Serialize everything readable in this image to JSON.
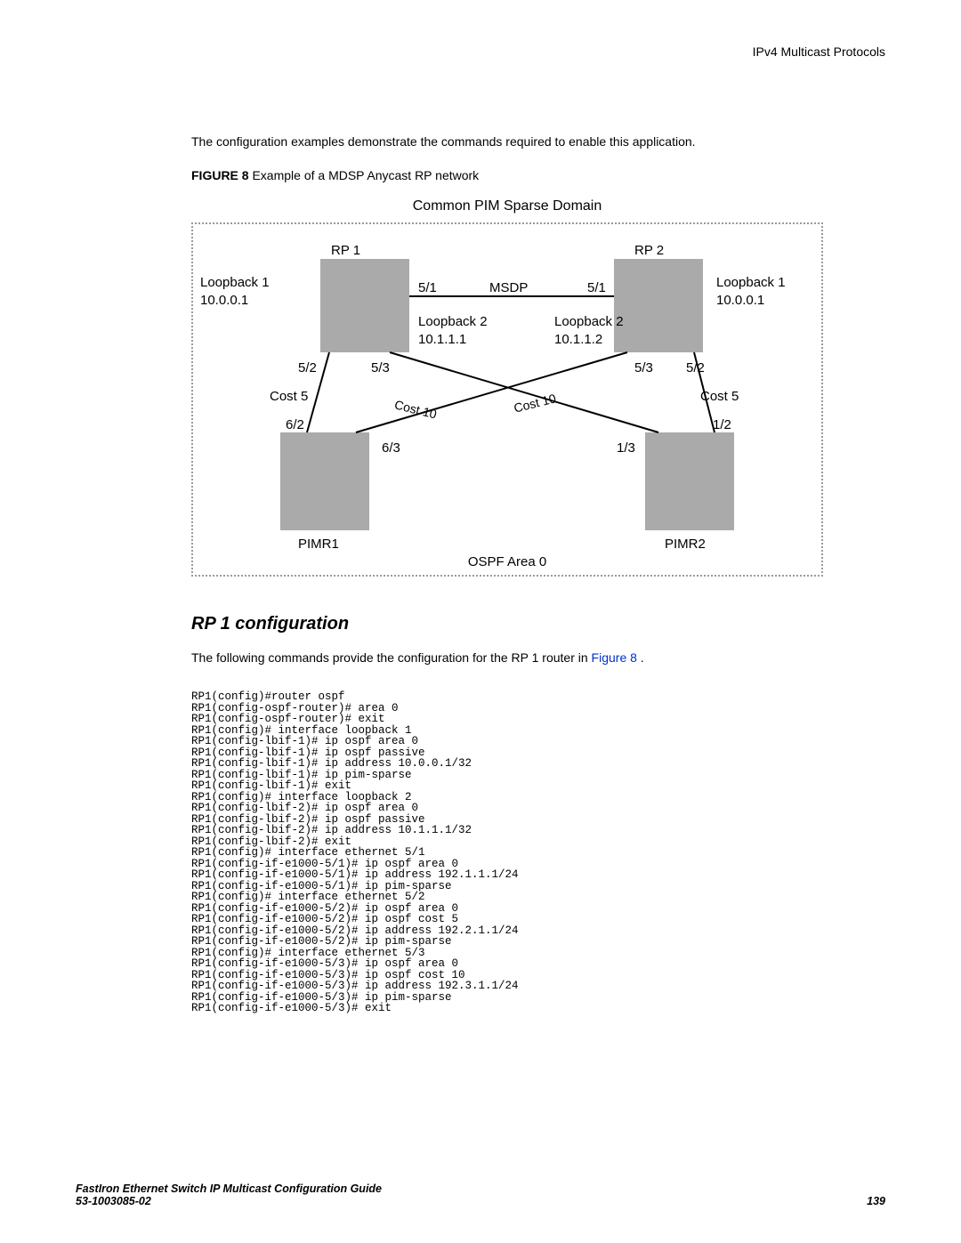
{
  "header": {
    "right": "IPv4 Multicast Protocols"
  },
  "intro": "The configuration examples demonstrate the commands required to enable this application.",
  "figure": {
    "label": "FIGURE 8",
    "title": "Example of a MDSP Anycast RP network"
  },
  "diagram": {
    "title": "Common PIM Sparse Domain",
    "rp1": "RP 1",
    "rp2": "RP 2",
    "lb1l1": "Loopback 1",
    "lb1l2": "10.0.0.1",
    "lb1r1": "Loopback 1",
    "lb1r2": "10.0.0.1",
    "msdp": "MSDP",
    "p51l": "5/1",
    "p51r": "5/1",
    "lb2l1": "Loopback 2",
    "lb2l2": "10.1.1.1",
    "lb2r1": "Loopback 2",
    "lb2r2": "10.1.1.2",
    "p52l": "5/2",
    "p53l": "5/3",
    "p53rt": "5/3",
    "p52r": "5/2",
    "cost5l": "Cost 5",
    "cost5r": "Cost 5",
    "cost10l": "Cost 10",
    "cost10r": "Cost 10",
    "p62": "6/2",
    "p63": "6/3",
    "p13": "1/3",
    "p12": "1/2",
    "pimr1": "PIMR1",
    "pimr2": "PIMR2",
    "ospf": "OSPF Area 0"
  },
  "section": {
    "heading": "RP 1 configuration",
    "para_pre": "The following commands provide the configuration for the RP 1 router in ",
    "link": "Figure 8",
    "para_post": " ."
  },
  "code": "RP1(config)#router ospf\nRP1(config-ospf-router)# area 0\nRP1(config-ospf-router)# exit\nRP1(config)# interface loopback 1\nRP1(config-lbif-1)# ip ospf area 0\nRP1(config-lbif-1)# ip ospf passive\nRP1(config-lbif-1)# ip address 10.0.0.1/32\nRP1(config-lbif-1)# ip pim-sparse\nRP1(config-lbif-1)# exit\nRP1(config)# interface loopback 2\nRP1(config-lbif-2)# ip ospf area 0\nRP1(config-lbif-2)# ip ospf passive\nRP1(config-lbif-2)# ip address 10.1.1.1/32\nRP1(config-lbif-2)# exit\nRP1(config)# interface ethernet 5/1\nRP1(config-if-e1000-5/1)# ip ospf area 0\nRP1(config-if-e1000-5/1)# ip address 192.1.1.1/24\nRP1(config-if-e1000-5/1)# ip pim-sparse\nRP1(config)# interface ethernet 5/2\nRP1(config-if-e1000-5/2)# ip ospf area 0\nRP1(config-if-e1000-5/2)# ip ospf cost 5\nRP1(config-if-e1000-5/2)# ip address 192.2.1.1/24\nRP1(config-if-e1000-5/2)# ip pim-sparse\nRP1(config)# interface ethernet 5/3\nRP1(config-if-e1000-5/3)# ip ospf area 0\nRP1(config-if-e1000-5/3)# ip ospf cost 10\nRP1(config-if-e1000-5/3)# ip address 192.3.1.1/24\nRP1(config-if-e1000-5/3)# ip pim-sparse\nRP1(config-if-e1000-5/3)# exit",
  "footer": {
    "line1": "FastIron Ethernet Switch IP Multicast Configuration Guide",
    "line2": "53-1003085-02",
    "page": "139"
  }
}
